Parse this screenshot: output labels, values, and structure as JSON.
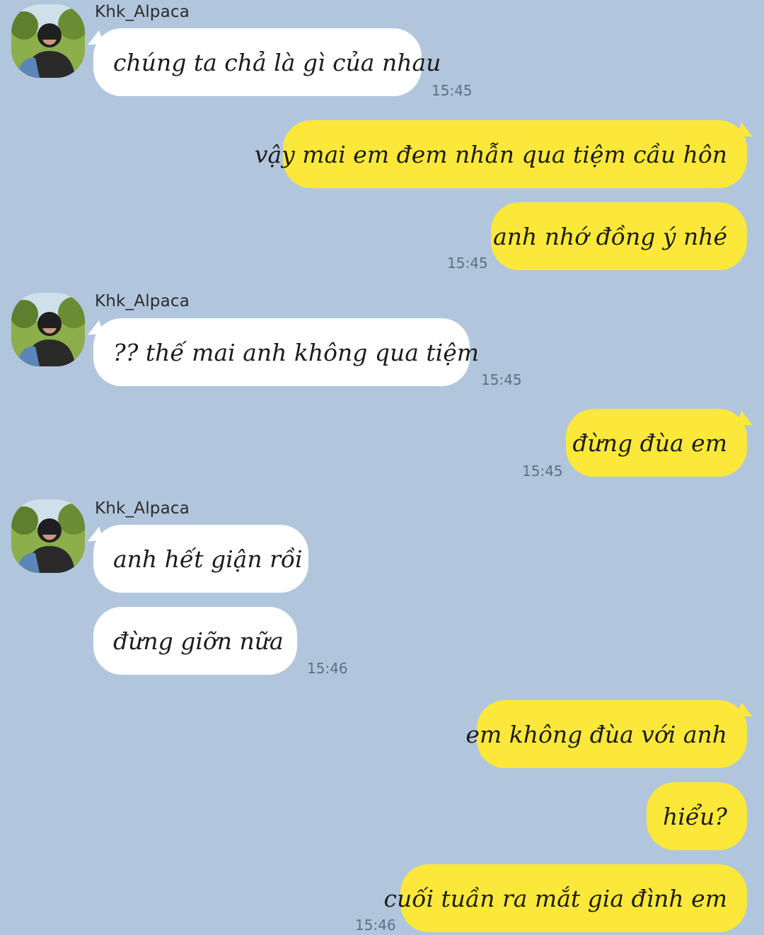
{
  "conversation": {
    "contact_name": "Khk_Alpaca",
    "avatar_icon": "profile-photo",
    "colors": {
      "background": "#b1c6dd",
      "incoming_bubble": "#ffffff",
      "outgoing_bubble": "#fbe83a",
      "timestamp": "#5f6f80"
    },
    "messages": [
      {
        "sender": "Khk_Alpaca",
        "direction": "incoming",
        "text": "chúng ta chả là gì của nhau"
      },
      {
        "sender": "me",
        "direction": "outgoing",
        "text": "vậy mai em đem nhẫn qua tiệm cầu hôn"
      },
      {
        "sender": "me",
        "direction": "outgoing",
        "text": "anh nhớ đồng ý nhé"
      },
      {
        "sender": "Khk_Alpaca",
        "direction": "incoming",
        "text": "?? thế mai anh không qua tiệm"
      },
      {
        "sender": "me",
        "direction": "outgoing",
        "text": "đừng đùa em"
      },
      {
        "sender": "Khk_Alpaca",
        "direction": "incoming",
        "text": "anh hết giận rồi"
      },
      {
        "sender": "Khk_Alpaca",
        "direction": "incoming",
        "text": "đừng giỡn nữa"
      },
      {
        "sender": "me",
        "direction": "outgoing",
        "text": "em không đùa với anh"
      },
      {
        "sender": "me",
        "direction": "outgoing",
        "text": "hiểu?"
      },
      {
        "sender": "me",
        "direction": "outgoing",
        "text": "cuối tuần ra mắt gia đình em"
      }
    ],
    "timestamps": [
      "15:45",
      "15:45",
      "15:45",
      "15:45",
      "15:46",
      "15:46"
    ]
  }
}
